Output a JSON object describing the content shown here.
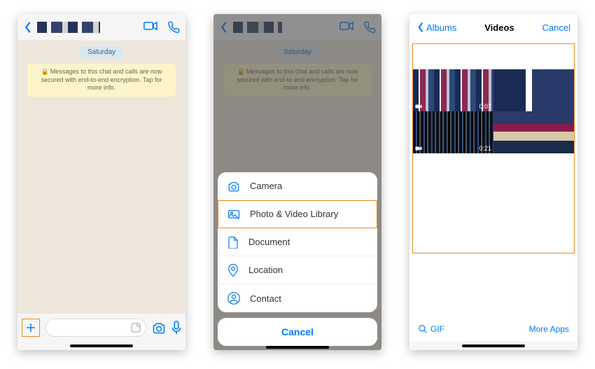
{
  "colors": {
    "ios_blue": "#007aff",
    "highlight": "#f08a24"
  },
  "chat": {
    "day": "Saturday",
    "encryption_notice": "Messages to this chat and calls are now secured with end-to-end encryption. Tap for more info."
  },
  "action_sheet": {
    "items": [
      {
        "icon": "camera-icon",
        "label": "Camera"
      },
      {
        "icon": "photo-icon",
        "label": "Photo & Video Library"
      },
      {
        "icon": "document-icon",
        "label": "Document"
      },
      {
        "icon": "location-icon",
        "label": "Location"
      },
      {
        "icon": "contact-icon",
        "label": "Contact"
      }
    ],
    "cancel": "Cancel",
    "highlighted_index": 1
  },
  "picker": {
    "back_label": "Albums",
    "title": "Videos",
    "cancel": "Cancel",
    "gif_label": "GIF",
    "more_apps": "More Apps",
    "thumbs": [
      {
        "duration": "0:07"
      },
      {
        "duration": ""
      },
      {
        "duration": "0:21"
      },
      {
        "duration": ""
      }
    ]
  }
}
